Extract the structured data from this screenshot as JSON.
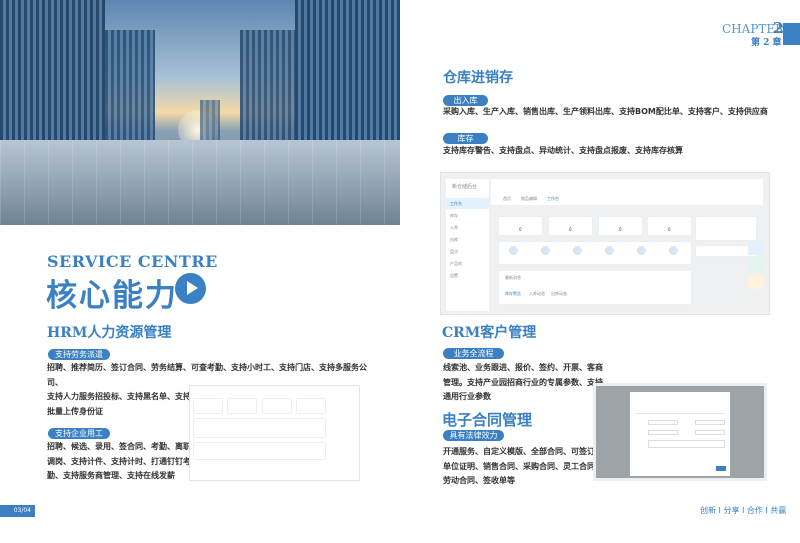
{
  "chapter": {
    "label": "CHAPTER",
    "number": "2",
    "cn": "第 2 章"
  },
  "hero": {
    "en": "SERVICE CENTRE",
    "cn": "核心能力",
    "play_icon": "play-icon"
  },
  "hrm": {
    "title": "HRM人力资源管理",
    "sections": [
      {
        "tag": "支持劳务派遣",
        "lines": [
          "招聘、推荐简历、签订合同、劳务结算、可查考勤、支持小时工、支持门店、支持多服务公司、",
          "支持人力服务招投标、支持黑名单、支持",
          "批量上传身份证"
        ]
      },
      {
        "tag": "支持企业用工",
        "lines": [
          "招聘、候选、录用、签合同、考勤、离职",
          "调岗、支持计件、支持计时、打通钉钉考",
          "勤、支持服务商管理、支持在线发薪"
        ]
      }
    ]
  },
  "warehouse": {
    "title": "仓库进销存",
    "sections": [
      {
        "tag": "出入库",
        "lines": [
          "采购入库、生产入库、销售出库、生产领料出库、支持BOM配比单、支持客户、支持供应商"
        ]
      },
      {
        "tag": "库存",
        "lines": [
          "支持库存警告、支持盘点、异动统计、支持盘点报废、支持库存核算"
        ]
      }
    ],
    "mockup": {
      "app": "新仓储后台",
      "sidebar": [
        "工作台",
        "库存",
        "入库",
        "出库",
        "盘点",
        "产品库",
        "设置"
      ],
      "tabs": [
        "首页",
        "物品编辑",
        "工作台"
      ],
      "stats": [
        "0",
        "0",
        "0",
        "0"
      ],
      "shortcuts": [
        "库存",
        "入库",
        "出库",
        "盘点",
        "报表",
        "产品库"
      ],
      "panel_title": "最新消息",
      "panel_tabs": [
        "库存警告",
        "入库动态",
        "出库动态"
      ]
    }
  },
  "crm": {
    "title": "CRM客户管理",
    "tag": "业务全流程",
    "lines": [
      "线索池、业务跟进、报价、签约、开票、客商",
      "管理。支持产业园招商行业的专属参数、支持",
      "通用行业参数"
    ]
  },
  "contract": {
    "title": "电子合同管理",
    "tag": "具有法律效力",
    "lines": [
      "开通服务、自定义模版、全部合同、可签订",
      "单位证明、销售合同、采购合同、灵工合同",
      "劳动合同、签收单等"
    ]
  },
  "footer": {
    "slogan": "创新 I 分享 I 合作 I 共赢",
    "page": "03/04"
  },
  "colors": {
    "accent": "#3a80c3"
  }
}
